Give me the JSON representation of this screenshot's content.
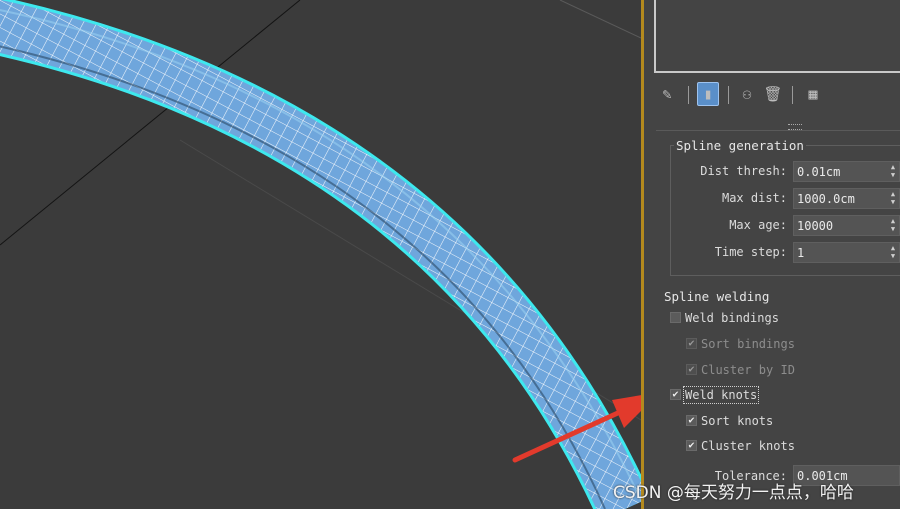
{
  "toolbar": {
    "icons": [
      "pin-icon",
      "show-end-result-icon",
      "make-unique-icon",
      "remove-modifier-icon",
      "configure-modifier-sets-icon"
    ]
  },
  "spline_generation": {
    "title": "Spline generation",
    "fields": [
      {
        "label": "Dist thresh:",
        "value": "0.01cm"
      },
      {
        "label": "Max dist:",
        "value": "1000.0cm"
      },
      {
        "label": "Max age:",
        "value": "10000"
      },
      {
        "label": "Time step:",
        "value": "1"
      }
    ]
  },
  "spline_welding": {
    "title": "Spline welding",
    "weld_bindings": {
      "label": "Weld bindings",
      "checked": false
    },
    "sort_bindings": {
      "label": "Sort bindings",
      "checked": true,
      "enabled": false
    },
    "cluster_by_id": {
      "label": "Cluster by ID",
      "checked": true,
      "enabled": false
    },
    "weld_knots": {
      "label": "Weld knots",
      "checked": true
    },
    "sort_knots": {
      "label": "Sort knots",
      "checked": true
    },
    "cluster_knots": {
      "label": "Cluster knots",
      "checked": true
    },
    "tolerance": {
      "label": "Tolerance:",
      "value": "0.001cm"
    }
  },
  "colors": {
    "viewport_bg": "#3b3b3b",
    "panel_bg": "#444444",
    "tube_fill": "#6fa6dc",
    "tube_outline": "#3ee8ee",
    "active_viewport_border": "#b48a1e",
    "annotation_arrow": "#e23a2c"
  },
  "watermark": "CSDN @每天努力一点点，哈哈"
}
